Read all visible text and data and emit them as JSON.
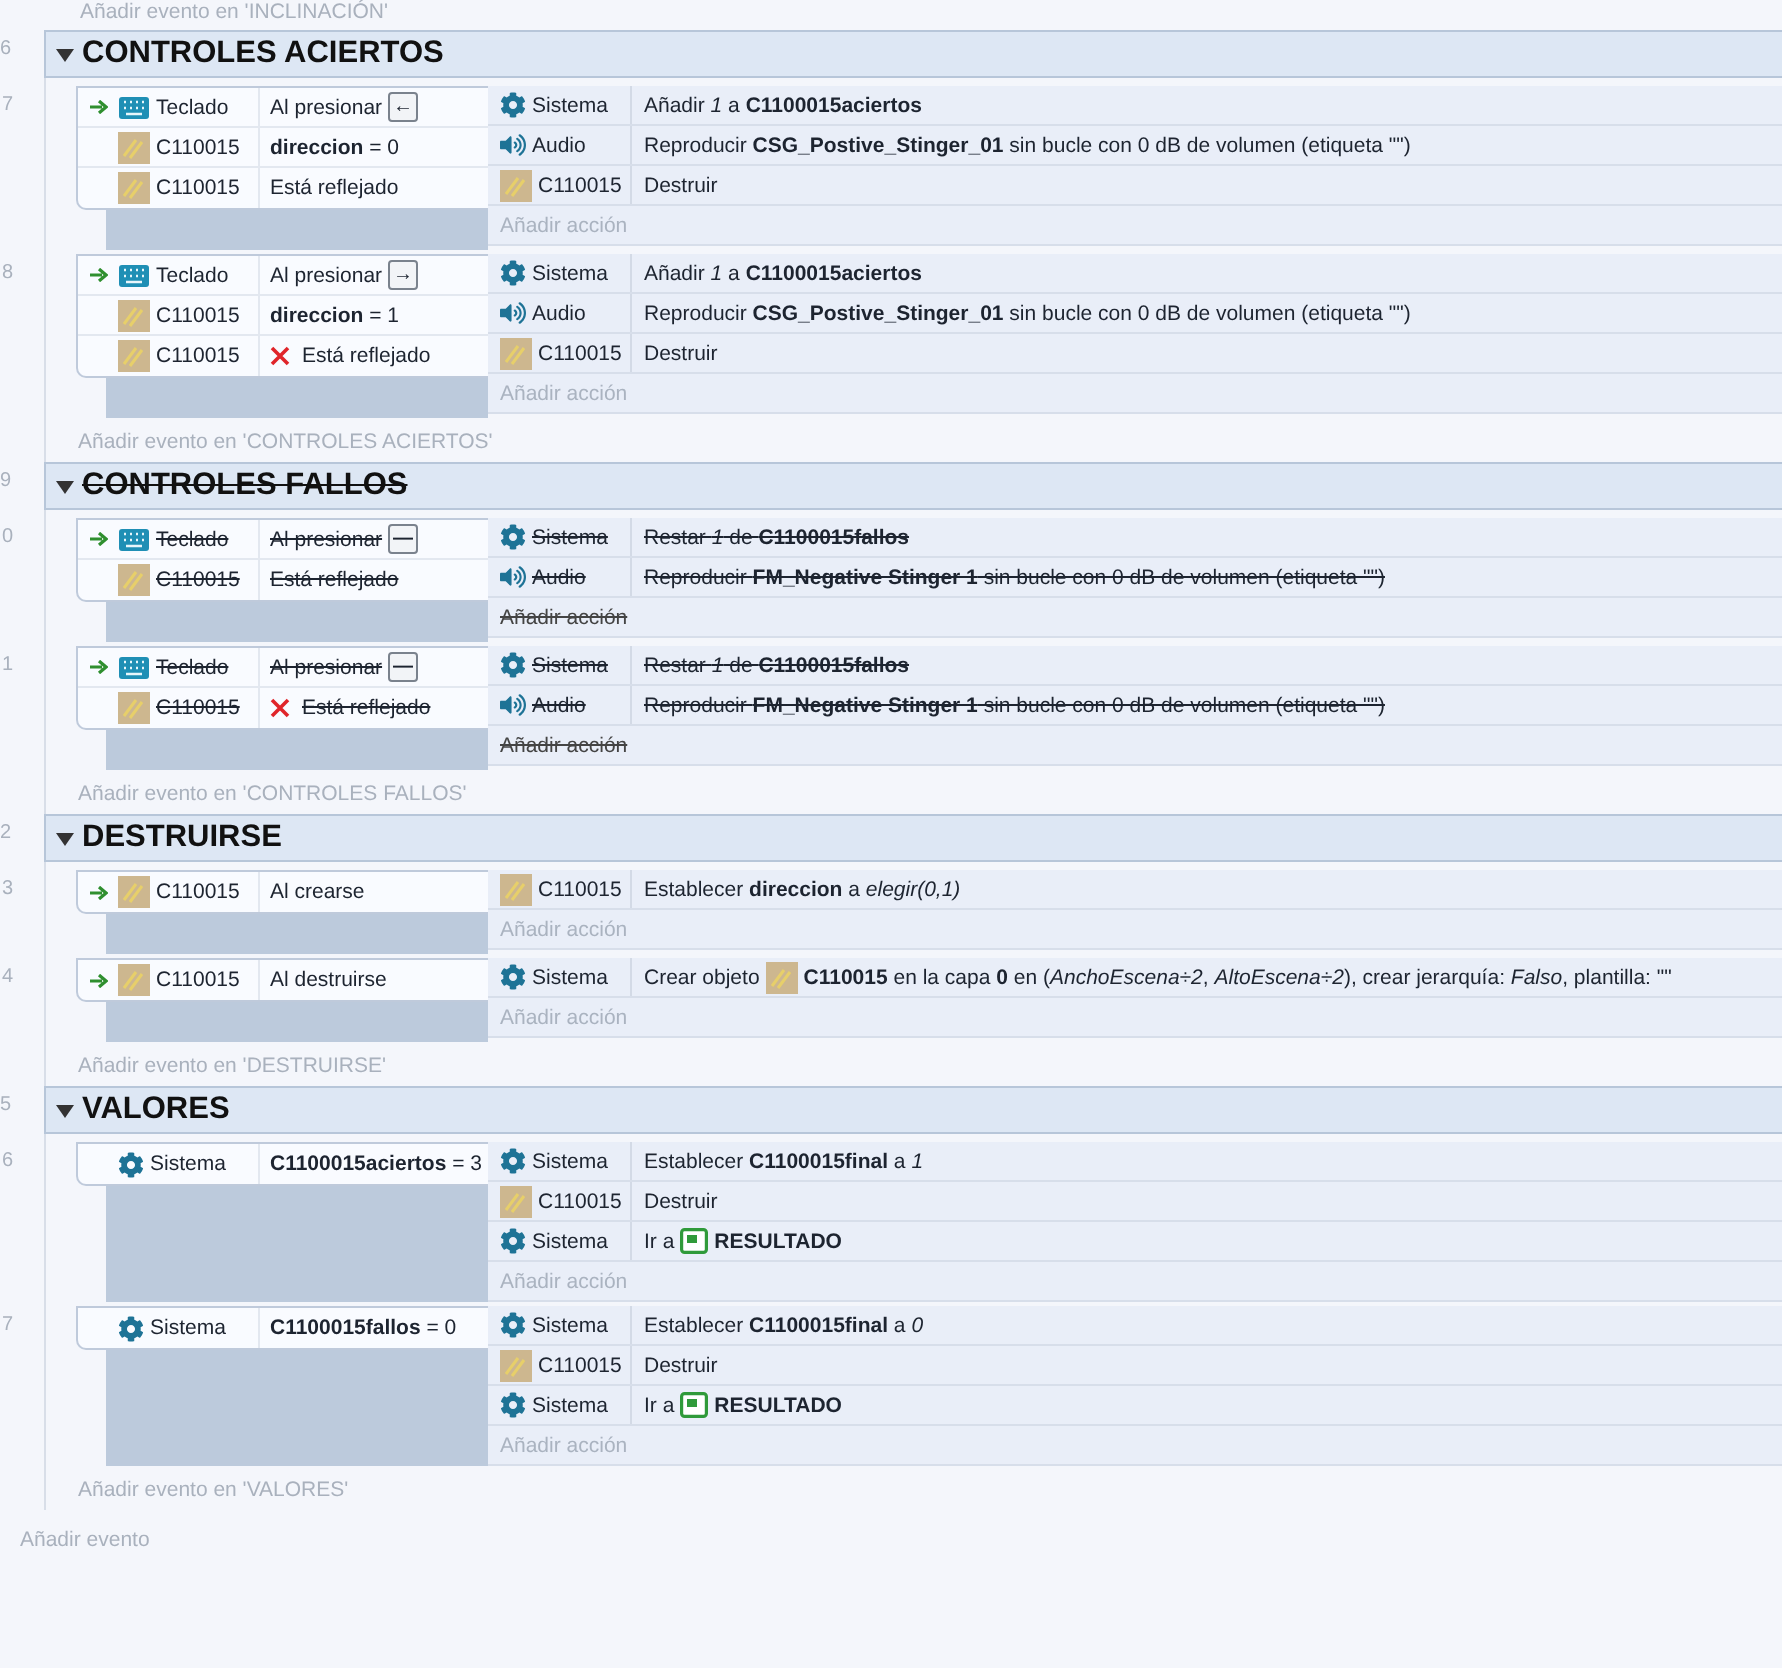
{
  "top_hint": "Añadir evento en 'INCLINACIÓN'",
  "groups": [
    {
      "number": "6",
      "title": "CONTROLES ACIERTOS",
      "expanded": true,
      "disabled": false,
      "events": [
        {
          "number": "7",
          "trigger": true,
          "conditions": [
            {
              "kind": "keyboard",
              "object": "Teclado",
              "text": "Al presionar",
              "key": "←",
              "inverted": false
            },
            {
              "kind": "sprite",
              "object": "C110015",
              "text": "**direccion** = 0",
              "inverted": false
            },
            {
              "kind": "sprite",
              "object": "C110015",
              "text": "Está reflejado",
              "inverted": false
            }
          ],
          "actions": [
            {
              "kind": "gear",
              "object": "Sistema",
              "text": "Añadir *1* a **C1100015aciertos**"
            },
            {
              "kind": "audio",
              "object": "Audio",
              "text": "Reproducir **CSG_Postive_Stinger_01** sin bucle con 0 dB de volumen (etiqueta \"\")"
            },
            {
              "kind": "sprite",
              "object": "C110015",
              "text": "Destruir"
            }
          ],
          "add_action": "Añadir acción"
        },
        {
          "number": "8",
          "trigger": true,
          "conditions": [
            {
              "kind": "keyboard",
              "object": "Teclado",
              "text": "Al presionar",
              "key": "→",
              "inverted": false
            },
            {
              "kind": "sprite",
              "object": "C110015",
              "text": "**direccion** = 1",
              "inverted": false
            },
            {
              "kind": "sprite",
              "object": "C110015",
              "text": "Está reflejado",
              "inverted": true
            }
          ],
          "actions": [
            {
              "kind": "gear",
              "object": "Sistema",
              "text": "Añadir *1* a **C1100015aciertos**"
            },
            {
              "kind": "audio",
              "object": "Audio",
              "text": "Reproducir **CSG_Postive_Stinger_01** sin bucle con 0 dB de volumen (etiqueta \"\")"
            },
            {
              "kind": "sprite",
              "object": "C110015",
              "text": "Destruir"
            }
          ],
          "add_action": "Añadir acción"
        }
      ],
      "add_event": "Añadir evento en 'CONTROLES ACIERTOS'"
    },
    {
      "number": "9",
      "title": "CONTROLES FALLOS",
      "expanded": true,
      "disabled": true,
      "events": [
        {
          "number": "0",
          "trigger": true,
          "conditions": [
            {
              "kind": "keyboard",
              "object": "Teclado",
              "text": "Al presionar",
              "key": "—",
              "inverted": false
            },
            {
              "kind": "sprite",
              "object": "C110015",
              "text": "Está reflejado",
              "inverted": false
            }
          ],
          "actions": [
            {
              "kind": "gear",
              "object": "Sistema",
              "text": "Restar *1* de **C1100015fallos**"
            },
            {
              "kind": "audio",
              "object": "Audio",
              "text": "Reproducir **FM_Negative Stinger 1** sin bucle con 0 dB de volumen (etiqueta \"\")"
            }
          ],
          "add_action": "Añadir acción"
        },
        {
          "number": "1",
          "trigger": true,
          "conditions": [
            {
              "kind": "keyboard",
              "object": "Teclado",
              "text": "Al presionar",
              "key": "—",
              "inverted": false
            },
            {
              "kind": "sprite",
              "object": "C110015",
              "text": "Está reflejado",
              "inverted": true
            }
          ],
          "actions": [
            {
              "kind": "gear",
              "object": "Sistema",
              "text": "Restar *1* de **C1100015fallos**"
            },
            {
              "kind": "audio",
              "object": "Audio",
              "text": "Reproducir **FM_Negative Stinger 1** sin bucle con 0 dB de volumen (etiqueta \"\")"
            }
          ],
          "add_action": "Añadir acción"
        }
      ],
      "add_event": "Añadir evento en 'CONTROLES FALLOS'"
    },
    {
      "number": "2",
      "title": "DESTRUIRSE",
      "expanded": true,
      "disabled": false,
      "events": [
        {
          "number": "3",
          "trigger": true,
          "conditions": [
            {
              "kind": "sprite",
              "object": "C110015",
              "text": "Al crearse",
              "inverted": false
            }
          ],
          "actions": [
            {
              "kind": "sprite",
              "object": "C110015",
              "text": "Establecer **direccion** a *elegir(0,1)*"
            }
          ],
          "add_action": "Añadir acción"
        },
        {
          "number": "4",
          "trigger": true,
          "conditions": [
            {
              "kind": "sprite",
              "object": "C110015",
              "text": "Al destruirse",
              "inverted": false
            }
          ],
          "actions": [
            {
              "kind": "gear",
              "object": "Sistema",
              "segments": [
                {
                  "kind": "text",
                  "text": "Crear objeto"
                },
                {
                  "kind": "sprite"
                },
                {
                  "kind": "text",
                  "text": "**C110015** en la capa **0** en (*AnchoEscena÷2*, *AltoEscena÷2*), crear jerarquía: *Falso*, plantilla: \"\""
                }
              ]
            }
          ],
          "add_action": "Añadir acción"
        }
      ],
      "add_event": "Añadir evento en 'DESTRUIRSE'"
    },
    {
      "number": "5",
      "title": "VALORES",
      "expanded": true,
      "disabled": false,
      "events": [
        {
          "number": "6",
          "trigger": false,
          "conditions": [
            {
              "kind": "gear",
              "object": "Sistema",
              "text": "**C1100015aciertos** = 3",
              "inverted": false
            }
          ],
          "actions": [
            {
              "kind": "gear",
              "object": "Sistema",
              "text": "Establecer **C1100015final** a *1*"
            },
            {
              "kind": "sprite",
              "object": "C110015",
              "text": "Destruir"
            },
            {
              "kind": "gear",
              "object": "Sistema",
              "segments": [
                {
                  "kind": "text",
                  "text": "Ir a"
                },
                {
                  "kind": "layout"
                },
                {
                  "kind": "text",
                  "text": "**RESULTADO**"
                }
              ]
            }
          ],
          "add_action": "Añadir acción"
        },
        {
          "number": "7",
          "trigger": false,
          "conditions": [
            {
              "kind": "gear",
              "object": "Sistema",
              "text": "**C1100015fallos** = 0",
              "inverted": false
            }
          ],
          "actions": [
            {
              "kind": "gear",
              "object": "Sistema",
              "text": "Establecer **C1100015final** a *0*"
            },
            {
              "kind": "sprite",
              "object": "C110015",
              "text": "Destruir"
            },
            {
              "kind": "gear",
              "object": "Sistema",
              "segments": [
                {
                  "kind": "text",
                  "text": "Ir a"
                },
                {
                  "kind": "layout"
                },
                {
                  "kind": "text",
                  "text": "**RESULTADO**"
                }
              ]
            }
          ],
          "add_action": "Añadir acción"
        }
      ],
      "add_event": "Añadir evento en 'VALORES'"
    }
  ],
  "add_event": "Añadir evento"
}
